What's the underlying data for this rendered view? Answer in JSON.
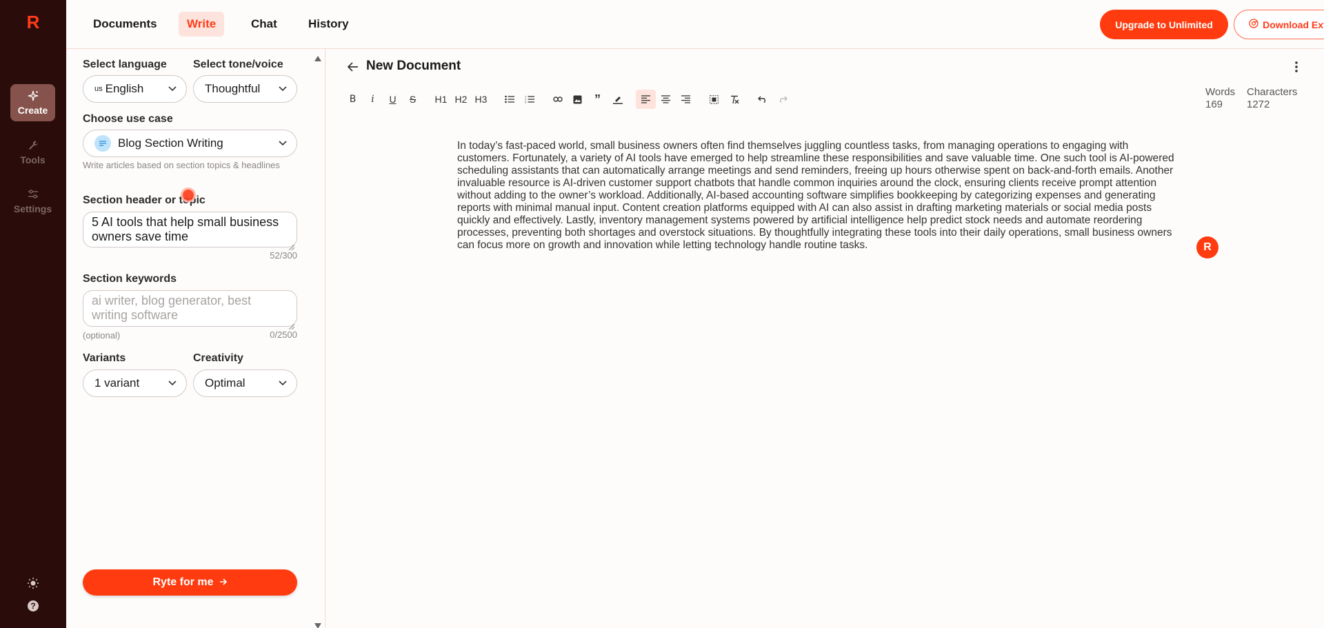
{
  "nav": {
    "tabs": [
      {
        "label": "Documents"
      },
      {
        "label": "Write"
      },
      {
        "label": "Chat"
      },
      {
        "label": "History"
      }
    ],
    "upgrade_label": "Upgrade to Unlimited",
    "extension_label": "Download Extension"
  },
  "rail": {
    "logo": "R",
    "items": [
      {
        "label": "Create",
        "icon": "sparkle-icon"
      },
      {
        "label": "Tools",
        "icon": "wrench-icon"
      },
      {
        "label": "Settings",
        "icon": "sliders-icon"
      }
    ]
  },
  "panel": {
    "language_label": "Select language",
    "language_flag": "us",
    "language_value": "English",
    "tone_label": "Select tone/voice",
    "tone_value": "Thoughtful",
    "usecase_label": "Choose use case",
    "usecase_value": "Blog Section Writing",
    "usecase_hint": "Write articles based on section topics & headlines",
    "header_label": "Section header or topic",
    "header_value": "5 AI tools that help small business owners save time",
    "header_counter": "52/300",
    "keywords_label": "Section keywords",
    "keywords_placeholder": "ai writer, blog generator, best writing software",
    "keywords_optional": "(optional)",
    "keywords_counter": "0/2500",
    "variants_label": "Variants",
    "variants_value": "1 variant",
    "creativity_label": "Creativity",
    "creativity_value": "Optimal",
    "ryte_label": "Ryte for me"
  },
  "editor": {
    "title": "New Document",
    "words_label": "Words",
    "words_value": "169",
    "chars_label": "Characters",
    "chars_value": "1272",
    "toolbar": {
      "h1": "H1",
      "h2": "H2",
      "h3": "H3"
    },
    "content": "In today’s fast-paced world, small business owners often find themselves juggling countless tasks, from managing operations to engaging with customers. Fortunately, a variety of AI tools have emerged to help streamline these responsibilities and save valuable time. One such tool is AI-powered scheduling assistants that can automatically arrange meetings and send reminders, freeing up hours otherwise spent on back-and-forth emails. Another invaluable resource is AI-driven customer support chatbots that handle common inquiries around the clock, ensuring clients receive prompt attention without adding to the owner’s workload. Additionally, AI-based accounting software simplifies bookkeeping by categorizing expenses and generating reports with minimal manual input. Content creation platforms equipped with AI can also assist in drafting marketing materials or social media posts quickly and effectively. Lastly, inventory management systems powered by artificial intelligence help predict stock needs and automate reordering processes, preventing both shortages and overstock situations. By thoughtfully integrating these tools into their daily operations, small business owners can focus more on growth and innovation while letting technology handle routine tasks.",
    "badge": "R"
  },
  "colors": {
    "accent": "#ff3b0f",
    "rail_bg": "#2a0d0b",
    "rail_active": "#85534c",
    "tab_active_bg": "#fde3dc"
  }
}
